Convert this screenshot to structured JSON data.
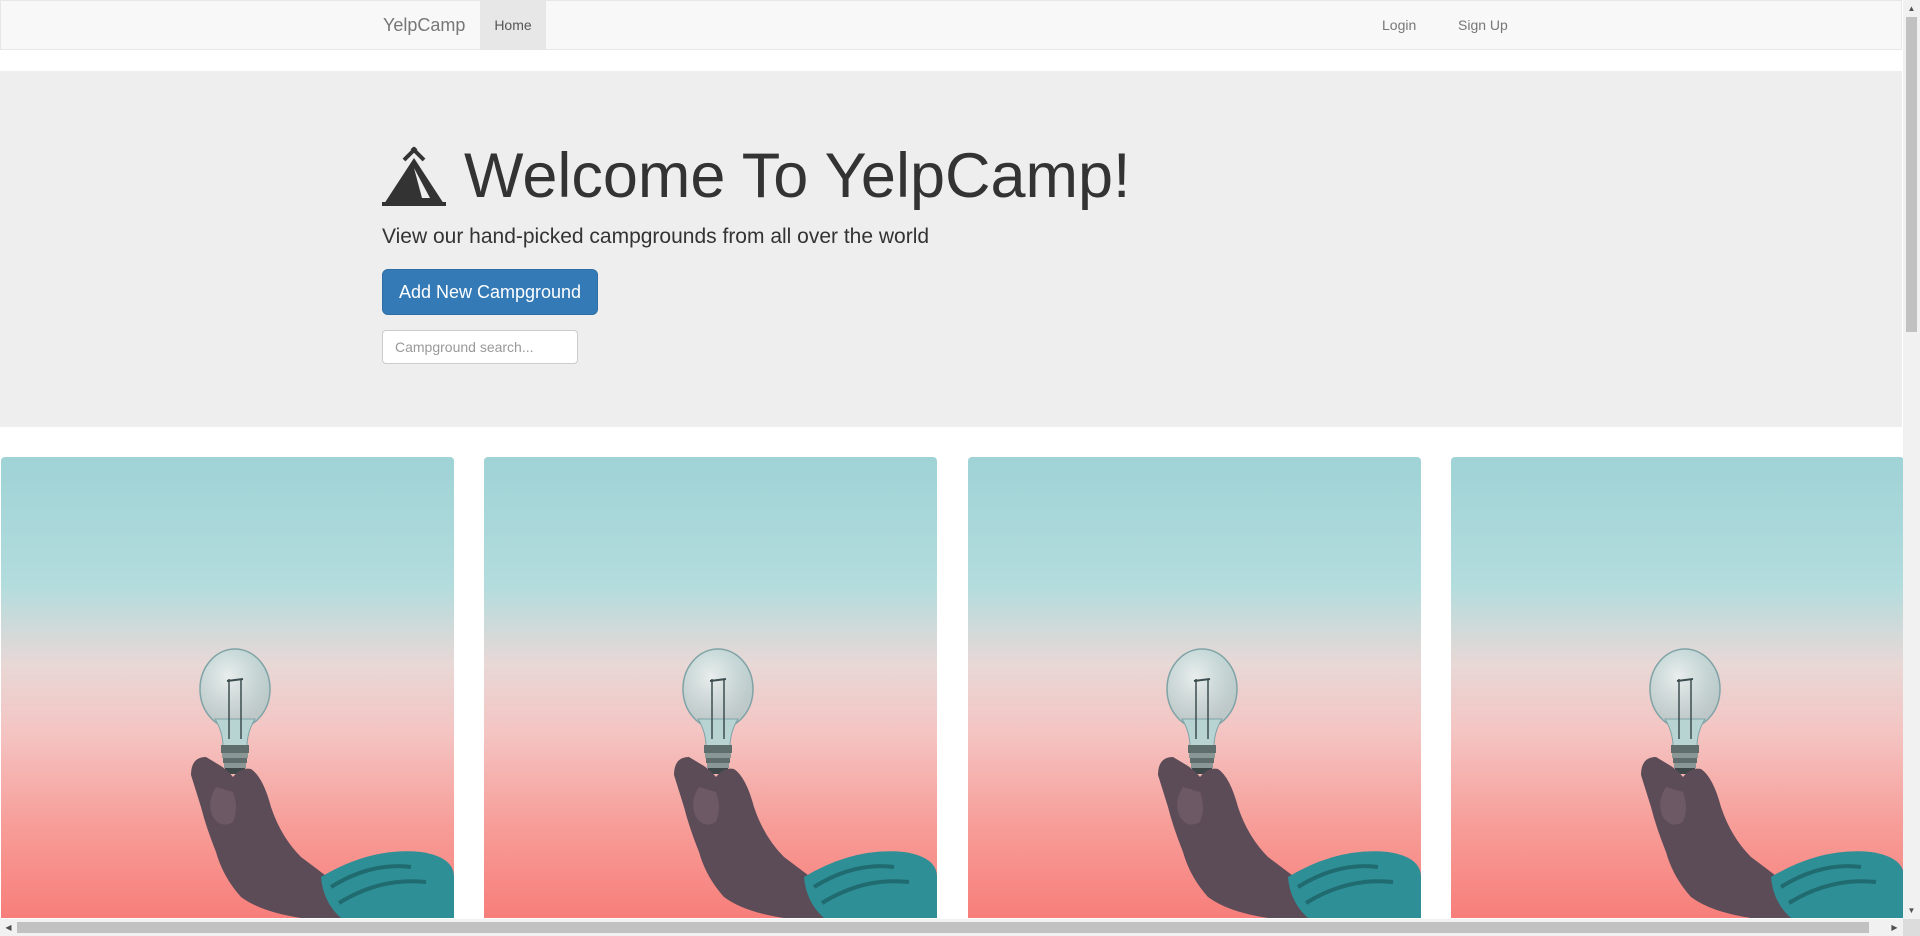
{
  "navbar": {
    "brand": "YelpCamp",
    "home_label": "Home",
    "login_label": "Login",
    "signup_label": "Sign Up"
  },
  "jumbotron": {
    "icon": "tent-icon",
    "title": "Welcome To YelpCamp!",
    "subtitle": "View our hand-picked campgrounds from all over the world",
    "add_button_label": "Add New Campground",
    "search_placeholder": "Campground search...",
    "search_value": ""
  },
  "campgrounds": [
    {
      "image": "lightbulb-in-hand-photo"
    },
    {
      "image": "lightbulb-in-hand-photo"
    },
    {
      "image": "lightbulb-in-hand-photo"
    },
    {
      "image": "lightbulb-in-hand-photo"
    }
  ],
  "colors": {
    "primary_button": "#337ab7",
    "jumbotron_bg": "#eeeeee",
    "navbar_bg": "#f8f8f8"
  }
}
